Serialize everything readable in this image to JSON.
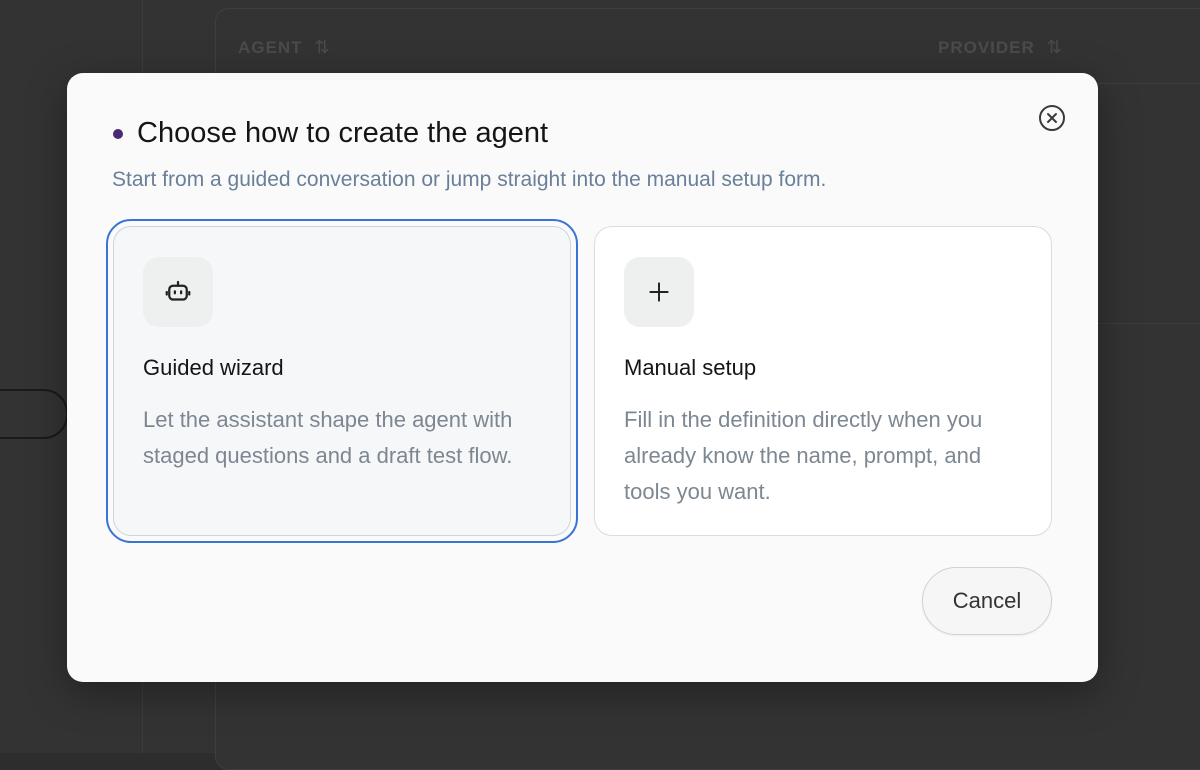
{
  "background": {
    "table_headers": [
      {
        "label": "AGENT",
        "sort_icon": "sort-arrows-icon"
      },
      {
        "label": "PROVIDER",
        "sort_icon": "sort-arrows-icon"
      }
    ]
  },
  "dialog": {
    "title": "Choose how to create the agent",
    "subtitle": "Start from a guided conversation or jump straight into the manual setup form.",
    "close_icon": "close-circle-icon",
    "options": [
      {
        "icon": "robot-icon",
        "title": "Guided wizard",
        "description": "Let the assistant shape the agent with staged questions and a draft test flow.",
        "selected": true
      },
      {
        "icon": "plus-icon",
        "title": "Manual setup",
        "description": "Fill in the definition directly when you already know the name, prompt, and tools you want.",
        "selected": false
      }
    ],
    "cancel_label": "Cancel"
  },
  "colors": {
    "accent_focus": "#3a73d6",
    "title_dot": "#4b2a73",
    "subtitle": "#6a7f99"
  }
}
